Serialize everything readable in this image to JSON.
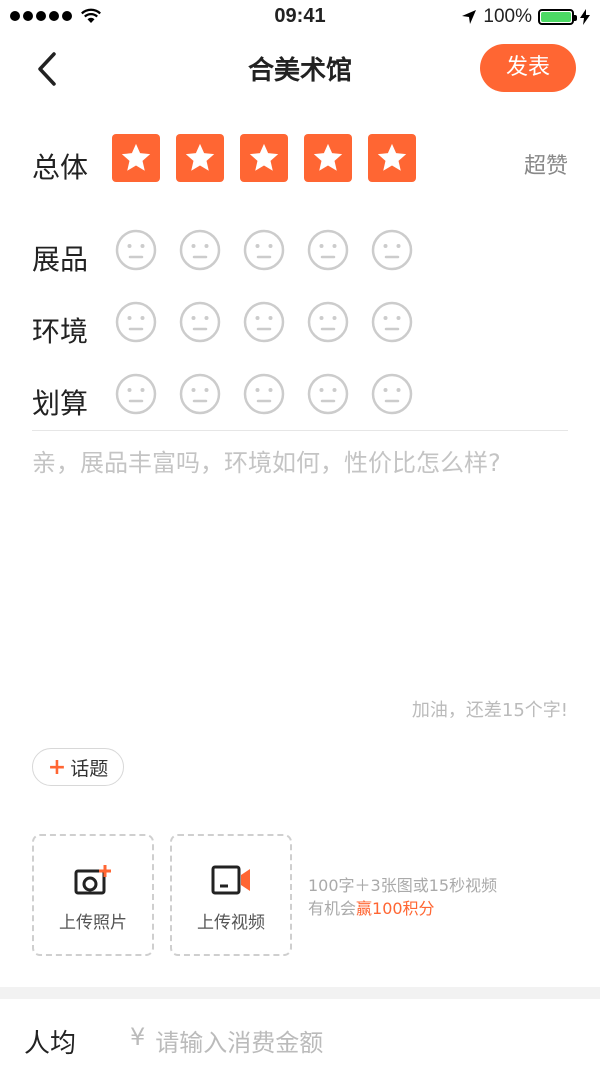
{
  "status_bar": {
    "time": "09:41",
    "battery": "100%",
    "battery_level": 1.0
  },
  "nav": {
    "title": "合美术馆",
    "publish_label": "发表",
    "back_icon": "chevron-left-icon"
  },
  "ratings": {
    "overall": {
      "label": "总体",
      "stars": 5,
      "max": 5,
      "desc": "超赞"
    },
    "exhibits": {
      "label": "展品",
      "score": 0,
      "max": 5
    },
    "environment": {
      "label": "环境",
      "score": 0,
      "max": 5
    },
    "value": {
      "label": "划算",
      "score": 0,
      "max": 5
    }
  },
  "comment": {
    "placeholder": "亲，展品丰富吗，环境如何，性价比怎么样?",
    "hint": "加油，还差15个字!"
  },
  "topic": {
    "plus": "+",
    "label": "话题"
  },
  "upload": {
    "photo_label": "上传照片",
    "video_label": "上传视频",
    "hint_line1": "100字＋3张图或15秒视频",
    "hint_line2_prefix": "有机会",
    "hint_line2_accent": "赢100积分"
  },
  "avg": {
    "label": "人均",
    "currency": "¥",
    "placeholder": "请输入消费金额"
  },
  "colors": {
    "accent": "#ff6633",
    "face": "#cccccc",
    "battery": "#4cd964"
  }
}
